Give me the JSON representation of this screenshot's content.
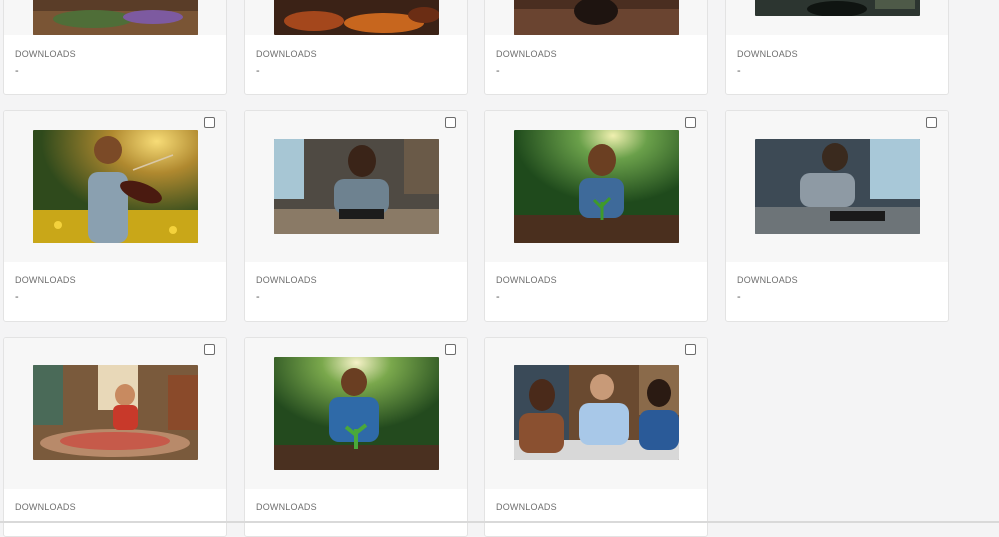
{
  "colors": {
    "page_bg": "#f4f4f5",
    "card_bg": "#ffffff",
    "thumb_bg": "#f7f7f7",
    "label": "#6e6e6e"
  },
  "download_label": "DOWNLOADS",
  "rows": [
    {
      "cards": [
        {
          "image": "herbs-on-wooden-table-image",
          "downloads": "-"
        },
        {
          "image": "autumn-leaves-image",
          "downloads": "-"
        },
        {
          "image": "soil-pot-image",
          "downloads": "-"
        },
        {
          "image": "dark-workshop-image",
          "downloads": "-"
        }
      ]
    },
    {
      "cards": [
        {
          "image": "boy-playing-violin-image",
          "downloads": "-"
        },
        {
          "image": "woman-assembling-drone-image",
          "downloads": "-"
        },
        {
          "image": "girl-planting-seedling-image",
          "downloads": "-"
        },
        {
          "image": "man-assembling-drone-image",
          "downloads": "-"
        }
      ]
    },
    {
      "cards": [
        {
          "image": "child-playing-on-rug-image",
          "downloads": ""
        },
        {
          "image": "boy-planting-seedling-image",
          "downloads": ""
        },
        {
          "image": "business-meeting-image",
          "downloads": ""
        }
      ]
    }
  ]
}
